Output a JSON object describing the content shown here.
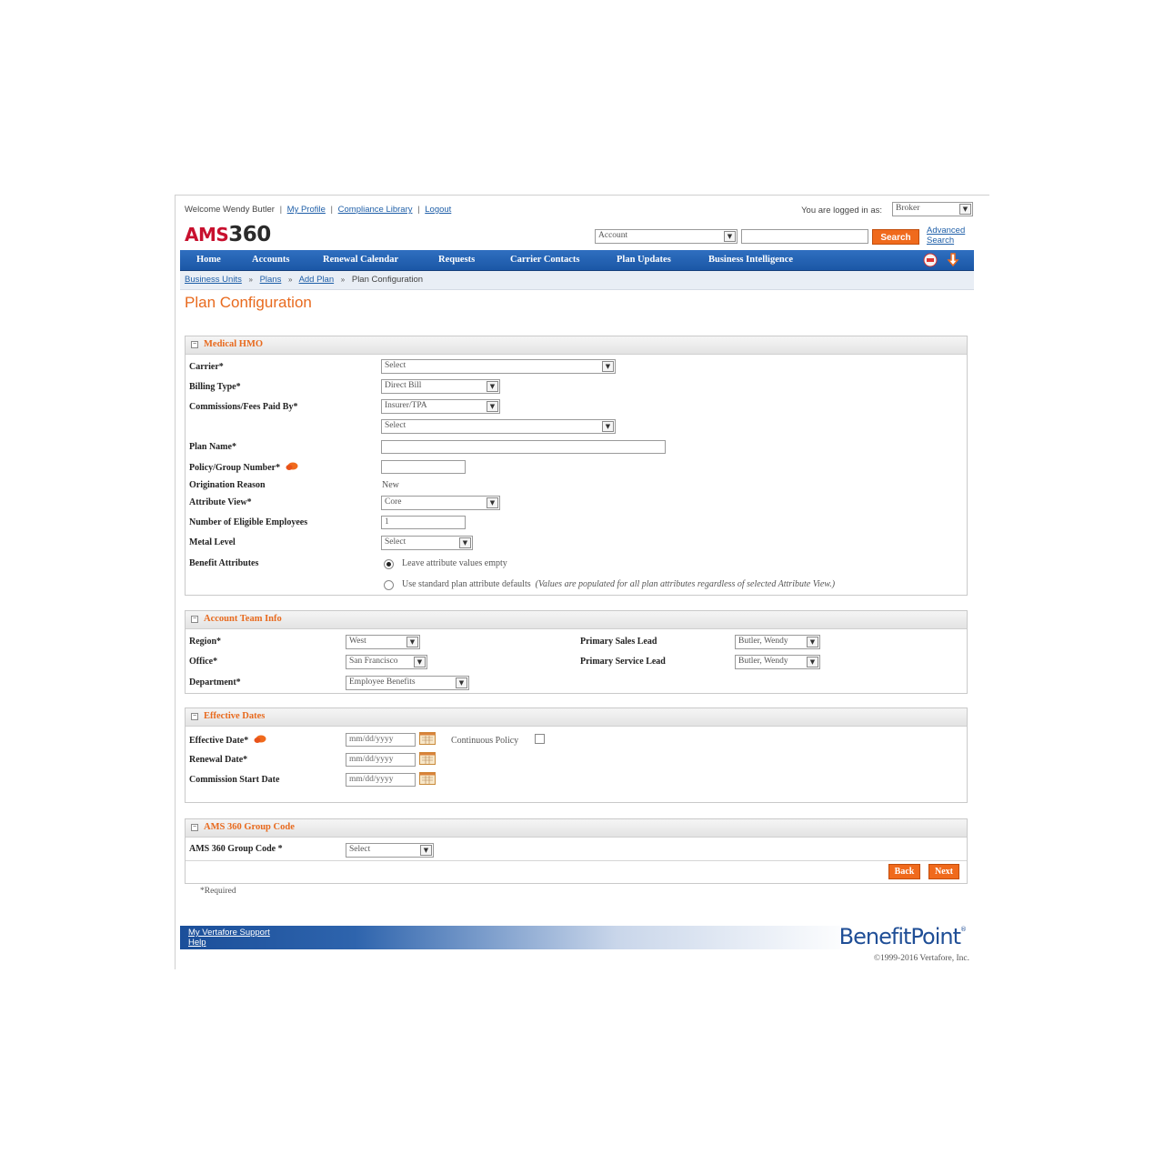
{
  "header": {
    "welcome": "Welcome Wendy Butler",
    "my_profile": "My Profile",
    "compliance_library": "Compliance Library",
    "logout": "Logout",
    "separator": "|",
    "logged_in_label": "You are logged in as:",
    "role_select": "Broker",
    "logo_ams": "AMS",
    "logo_num": "360",
    "search_type": "Account",
    "search_value": "",
    "search_button": "Search",
    "advanced_search": "Advanced Search"
  },
  "nav": {
    "items": [
      "Home",
      "Accounts",
      "Renewal Calendar",
      "Requests",
      "Carrier Contacts",
      "Plan Updates",
      "Business Intelligence"
    ],
    "icons": [
      "pdf-icon",
      "download-arrow-icon"
    ]
  },
  "breadcrumb": {
    "items": [
      "Business Units",
      "Plans",
      "Add Plan"
    ],
    "current": "Plan Configuration",
    "separator": "»"
  },
  "page_title": "Plan Configuration",
  "medical": {
    "title": "Medical HMO",
    "carrier_label": "Carrier*",
    "carrier_value": "Select",
    "billing_label": "Billing Type*",
    "billing_value": "Direct Bill",
    "commissions_label": "Commissions/Fees Paid By*",
    "commissions_value": "Insurer/TPA",
    "commissions_sub_value": "Select",
    "plan_name_label": "Plan Name*",
    "plan_name_value": "",
    "policy_label": "Policy/Group Number*",
    "policy_value": "",
    "origination_label": "Origination Reason",
    "origination_value": "New",
    "attribute_view_label": "Attribute View*",
    "attribute_view_value": "Core",
    "eligible_label": "Number of Eligible Employees",
    "eligible_value": "1",
    "metal_label": "Metal Level",
    "metal_value": "Select",
    "benefit_label": "Benefit Attributes",
    "radio_empty": "Leave attribute values empty",
    "radio_defaults": "Use standard plan attribute defaults",
    "radio_defaults_note": "(Values are populated for all plan attributes regardless of selected Attribute View.)",
    "selected_radio": "empty"
  },
  "account_team": {
    "title": "Account Team Info",
    "region_label": "Region*",
    "region_value": "West",
    "office_label": "Office*",
    "office_value": "San Francisco",
    "department_label": "Department*",
    "department_value": "Employee Benefits",
    "sales_lead_label": "Primary Sales Lead",
    "sales_lead_value": "Butler, Wendy",
    "service_lead_label": "Primary Service Lead",
    "service_lead_value": "Butler, Wendy"
  },
  "effective_dates": {
    "title": "Effective Dates",
    "effective_label": "Effective Date*",
    "effective_placeholder": "mm/dd/yyyy",
    "renewal_label": "Renewal Date*",
    "renewal_placeholder": "mm/dd/yyyy",
    "commission_label": "Commission Start Date",
    "commission_placeholder": "mm/dd/yyyy",
    "continuous_label": "Continuous Policy",
    "continuous_checked": false
  },
  "group_code": {
    "title": "AMS 360 Group Code",
    "label": "AMS 360 Group Code *",
    "value": "Select"
  },
  "buttons": {
    "back": "Back",
    "next": "Next"
  },
  "required_note": "*Required",
  "footer": {
    "support": "My Vertafore Support",
    "help": "Help",
    "brand_benefit": "Benefit",
    "brand_point": "Point",
    "brand_reg": "®",
    "copyright": "©1999-2016 Vertafore, Inc."
  },
  "colors": {
    "accent_orange": "#f06a1c",
    "nav_blue": "#1b57a6",
    "brand_red": "#c8102e",
    "link_blue": "#1f5fa8"
  }
}
